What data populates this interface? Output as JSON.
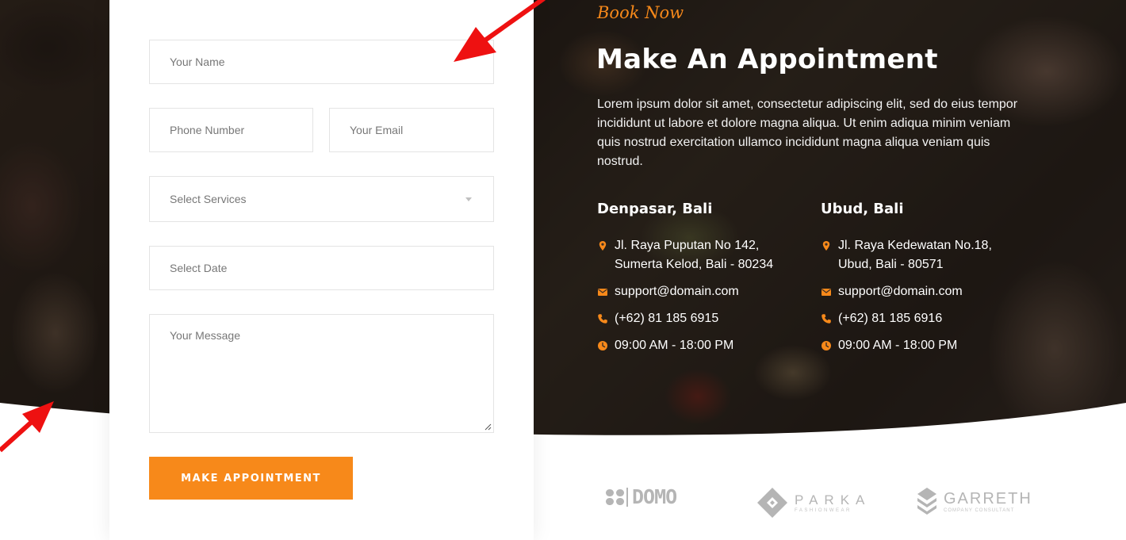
{
  "form": {
    "name_placeholder": "Your Name",
    "phone_placeholder": "Phone Number",
    "email_placeholder": "Your Email",
    "services_placeholder": "Select Services",
    "date_placeholder": "Select Date",
    "message_placeholder": "Your Message",
    "submit_label": "MAKE APPOINTMENT"
  },
  "header": {
    "kicker": "Book Now",
    "title": "Make An Appointment",
    "description": "Lorem ipsum dolor sit amet, consectetur adipiscing elit, sed do eius tempor incididunt ut labore et dolore magna aliqua. Ut enim adiqua minim veniam quis nostrud exercitation ullamco incididunt magna aliqua veniam quis nostrud."
  },
  "locations": [
    {
      "name": "Denpasar, Bali",
      "address_line1": "Jl. Raya Puputan No 142,",
      "address_line2": "Sumerta Kelod, Bali - 80234",
      "email": "support@domain.com",
      "phone": "(+62) 81 185 6915",
      "hours": "09:00 AM - 18:00 PM"
    },
    {
      "name": "Ubud, Bali",
      "address_line1": "Jl. Raya Kedewatan No.18,",
      "address_line2": "Ubud, Bali - 80571",
      "email": "support@domain.com",
      "phone": "(+62) 81 185 6916",
      "hours": "09:00 AM - 18:00 PM"
    }
  ],
  "partners": {
    "domo": "DOMO",
    "parka": "PARKA",
    "parka_sub": "FASHIONWEAR",
    "garreth": "GARRETH",
    "garreth_sub": "COMPANY CONSULTANT"
  },
  "colors": {
    "accent": "#f7891a",
    "annotation_arrow": "#ee1111"
  }
}
